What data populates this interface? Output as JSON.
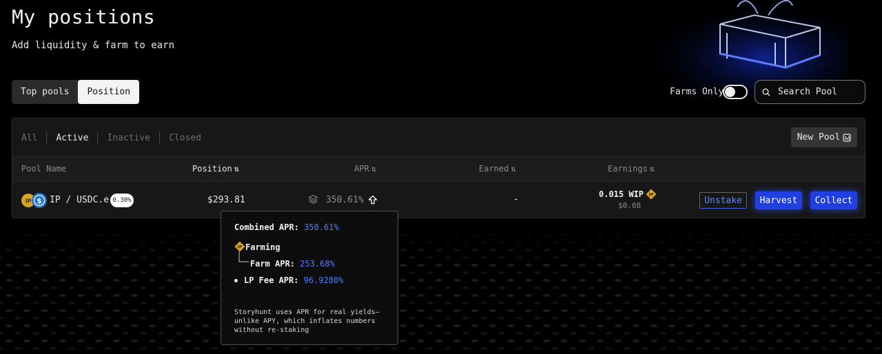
{
  "header": {
    "title": "My positions",
    "subtitle": "Add liquidity & farm to earn"
  },
  "tabs": [
    {
      "label": "Top pools",
      "active": false
    },
    {
      "label": "Position",
      "active": true
    }
  ],
  "filter_bar": {
    "farms_only_label": "Farms Only",
    "farms_only_enabled": true,
    "search_placeholder": "Search Pool"
  },
  "status_filters": [
    {
      "label": "All",
      "active": false
    },
    {
      "label": "Active",
      "active": true
    },
    {
      "label": "Inactive",
      "active": false
    },
    {
      "label": "Closed",
      "active": false
    }
  ],
  "new_pool_label": "New Pool",
  "table": {
    "columns": {
      "pool_name": "Pool Name",
      "position": "Position",
      "apr": "APR",
      "earned": "Earned",
      "earnings": "Earnings"
    },
    "rows": [
      {
        "pair": "IP / USDC.e",
        "fee_tier": "0.30%",
        "position": "$293.81",
        "apr": "350.61%",
        "earned": "-",
        "earnings_token": "0.015 WIP",
        "earnings_usd": "$0.08",
        "actions": {
          "unstake": "Unstake",
          "harvest": "Harvest",
          "collect": "Collect"
        }
      }
    ]
  },
  "apr_tooltip": {
    "combined_label": "Combined APR:",
    "combined_value": "350.61%",
    "farming_label": "Farming",
    "farm_apr_label": "Farm APR:",
    "farm_apr_value": "253.68%",
    "lp_fee_label": "LP Fee APR:",
    "lp_fee_value": "96.9280%",
    "note": "Storyhunt uses APR for real yields—unlike APY, which inflates numbers without re-staking"
  },
  "colors": {
    "accent_blue": "#1f3fe0",
    "link_blue": "#4f7dff",
    "token_gold": "#d9a520",
    "usdc_blue": "#2775ca"
  }
}
